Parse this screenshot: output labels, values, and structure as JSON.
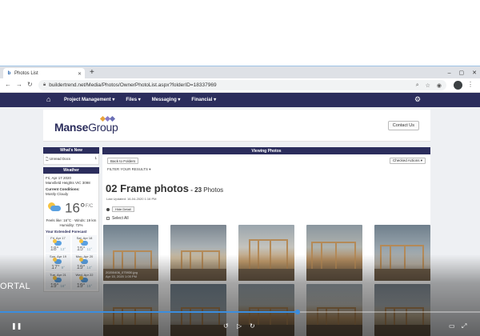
{
  "browser": {
    "tab_title": "Photos List",
    "new_tab": "+",
    "url": "buildertrend.net/Media/Photos/OwnerPhotoList.aspx?folderID=18337969"
  },
  "appnav": {
    "items": [
      "Project Management ▾",
      "Files ▾",
      "Messaging ▾",
      "Financial ▾"
    ]
  },
  "brand": {
    "name_bold": "Manse",
    "name_rest": "Group",
    "diamond_colors": [
      "#e8a33c",
      "#8a7bc8",
      "#6b6fb5"
    ],
    "contact_label": "Contact Us"
  },
  "sidebar": {
    "whats_new_header": "What's New",
    "whats_new_item": "Unread Docs",
    "whats_new_count": "1",
    "weather_header": "Weather",
    "date": "Fri, Apr 17 2020",
    "location": "Mansfield Heights VIC 3098",
    "conditions_label": "Current Conditions:",
    "conditions": "Mostly Cloudy",
    "temp": "16°",
    "temp_unit": "F/C",
    "details": "Feels like: 16°C · Winds: 19 km",
    "humidity": "Humidity: 72%",
    "forecast_title": "Your Extended Forecast",
    "forecast": [
      {
        "day": "Fri, Apr 17",
        "hi": "18°",
        "lo": "13°"
      },
      {
        "day": "Sat, Apr 18",
        "hi": "15°",
        "lo": "11°"
      },
      {
        "day": "Sun, Apr 19",
        "hi": "17°",
        "lo": "9°"
      },
      {
        "day": "Mon, Apr 20",
        "hi": "19°",
        "lo": "14°"
      },
      {
        "day": "Tue, Apr 21",
        "hi": "19°",
        "lo": "16°"
      },
      {
        "day": "Wed, Apr 22",
        "hi": "19°",
        "lo": "15°"
      }
    ]
  },
  "main": {
    "header": "Viewing Photos",
    "back_label": "Back to Folders",
    "checked_actions": "Checked Actions ▾",
    "filter_label": "FILTER YOUR RESULTS ▾",
    "folder_title": "02 Frame photos",
    "dash": " - ",
    "count": "23",
    "count_unit": " Photos",
    "last_updated": "Last Updated: 16-04-2020 1:16 PM",
    "hide_detail": "Hide Detail",
    "select_all": "Select All",
    "first_caption_name": "20200406_075930.jpg",
    "first_caption_date": "Apr 15, 2020 1:05 PM"
  },
  "video": {
    "ortal_text": "ORTAL",
    "progress": 0.62
  },
  "colors": {
    "nav": "#2b2d5c",
    "accent": "#3b8dde"
  }
}
